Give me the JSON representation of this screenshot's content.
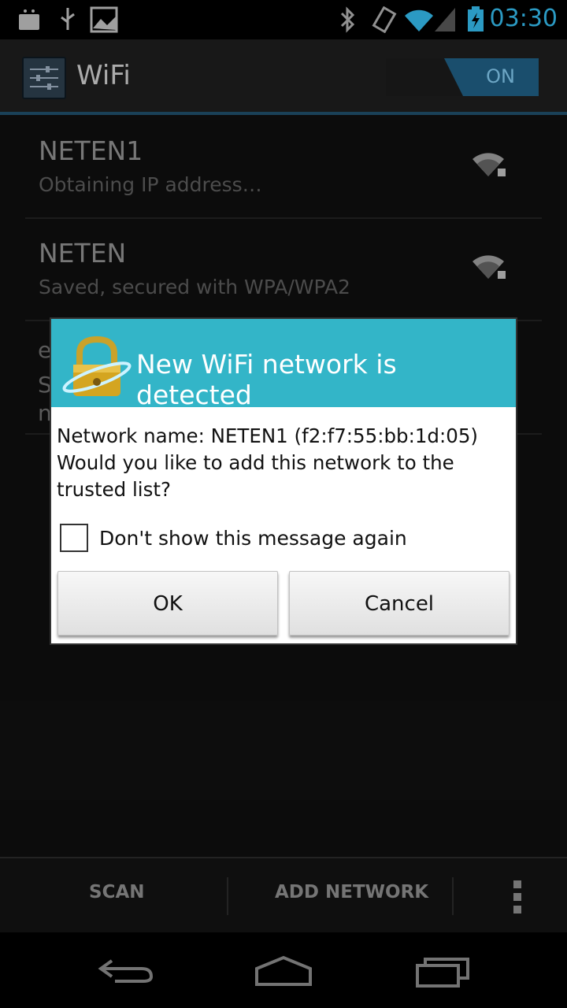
{
  "status_bar": {
    "time": "03:30",
    "icons": [
      "android-debug-icon",
      "usb-icon",
      "gallery-icon",
      "bluetooth-icon",
      "vibrate-icon",
      "wifi-signal-icon",
      "cell-signal-icon",
      "battery-charging-icon"
    ]
  },
  "action_bar": {
    "title": "WiFi",
    "toggle_label": "ON",
    "icon": "settings-sliders-icon"
  },
  "networks": [
    {
      "name": "NETEN1",
      "status": "Obtaining IP address…"
    },
    {
      "name": "NETEN",
      "status": "Saved, secured with WPA/WPA2"
    }
  ],
  "partial_network": {
    "line1": "e",
    "line2": "S",
    "line3": "n"
  },
  "dialog": {
    "title": "New WiFi network is detected",
    "network_line": "Network name: NETEN1 (f2:f7:55:bb:1d:05)",
    "question": "Would you like to add this network to the trusted list?",
    "checkbox_label": "Don't show this message again",
    "ok_label": "OK",
    "cancel_label": "Cancel"
  },
  "bottom_bar": {
    "scan_label": "SCAN",
    "add_label": "ADD NETWORK"
  },
  "colors": {
    "accent": "#33b5e5",
    "dialog_header": "#33b5c8"
  }
}
